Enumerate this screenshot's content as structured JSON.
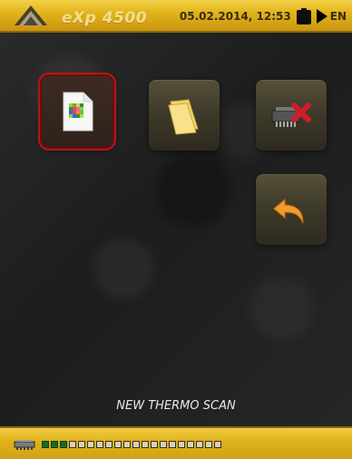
{
  "app": {
    "logo_text": "eXp 4500"
  },
  "status": {
    "datetime": "05.02.2014, 12:53",
    "language": "EN"
  },
  "tiles": [
    {
      "name": "thermo-scan-file-icon"
    },
    {
      "name": "folder-icon"
    },
    {
      "name": "memory-delete-icon"
    },
    {
      "name": "back-icon"
    }
  ],
  "caption": {
    "text": "NEW THERMO SCAN"
  },
  "bottom": {
    "signal": {
      "total_cells": 20,
      "active_cells": 3
    }
  },
  "colors": {
    "accent_gold": "#e1b51a",
    "selected_border": "#b11818",
    "signal_green": "#1a6b28"
  }
}
